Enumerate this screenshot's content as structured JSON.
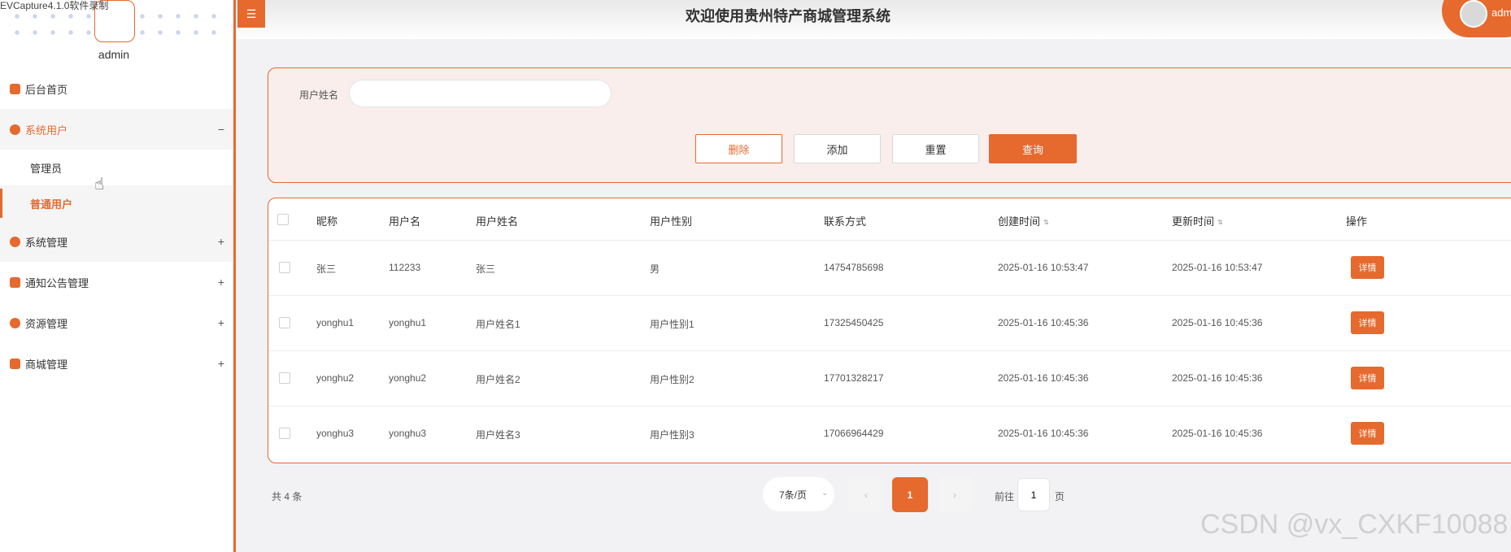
{
  "recorder": {
    "text": "EVCapture4.1.0软件录制"
  },
  "header": {
    "title": "欢迎使用贵州特产商城管理系统",
    "user_name": "adm"
  },
  "sidebar": {
    "username": "admin",
    "menu": [
      {
        "label": "后台首页",
        "sign": ""
      },
      {
        "label": "系统用户",
        "sign": "−"
      },
      {
        "label": "系统管理",
        "sign": "+"
      },
      {
        "label": "通知公告管理",
        "sign": "+"
      },
      {
        "label": "资源管理",
        "sign": "+"
      },
      {
        "label": "商城管理",
        "sign": "+"
      }
    ],
    "submenu": [
      {
        "label": "管理员"
      },
      {
        "label": "普通用户"
      }
    ]
  },
  "search": {
    "label": "用户姓名",
    "value": "",
    "buttons": {
      "delete": "删除",
      "add": "添加",
      "reset": "重置",
      "query": "查询"
    }
  },
  "table": {
    "columns": [
      "昵称",
      "用户名",
      "用户姓名",
      "用户性别",
      "联系方式",
      "创建时间",
      "更新时间",
      "操作"
    ],
    "sort_icon": "⇅",
    "detail_label": "详情",
    "rows": [
      {
        "nickname": "张三",
        "username": "112233",
        "realname": "张三",
        "gender": "男",
        "phone": "14754785698",
        "created": "2025-01-16 10:53:47",
        "updated": "2025-01-16 10:53:47"
      },
      {
        "nickname": "yonghu1",
        "username": "yonghu1",
        "realname": "用户姓名1",
        "gender": "用户性别1",
        "phone": "17325450425",
        "created": "2025-01-16 10:45:36",
        "updated": "2025-01-16 10:45:36"
      },
      {
        "nickname": "yonghu2",
        "username": "yonghu2",
        "realname": "用户姓名2",
        "gender": "用户性别2",
        "phone": "17701328217",
        "created": "2025-01-16 10:45:36",
        "updated": "2025-01-16 10:45:36"
      },
      {
        "nickname": "yonghu3",
        "username": "yonghu3",
        "realname": "用户姓名3",
        "gender": "用户性别3",
        "phone": "17066964429",
        "created": "2025-01-16 10:45:36",
        "updated": "2025-01-16 10:45:36"
      }
    ]
  },
  "pagination": {
    "total": "共 4 条",
    "page_size": "7条/页",
    "prev": "‹",
    "current": "1",
    "next": "›",
    "goto_label": "前往",
    "goto_value": "1",
    "goto_suffix": "页"
  },
  "watermark": "CSDN @vx_CXKF10088",
  "colors": {
    "accent": "#e6692e",
    "panel_bg": "#f9eeec"
  }
}
